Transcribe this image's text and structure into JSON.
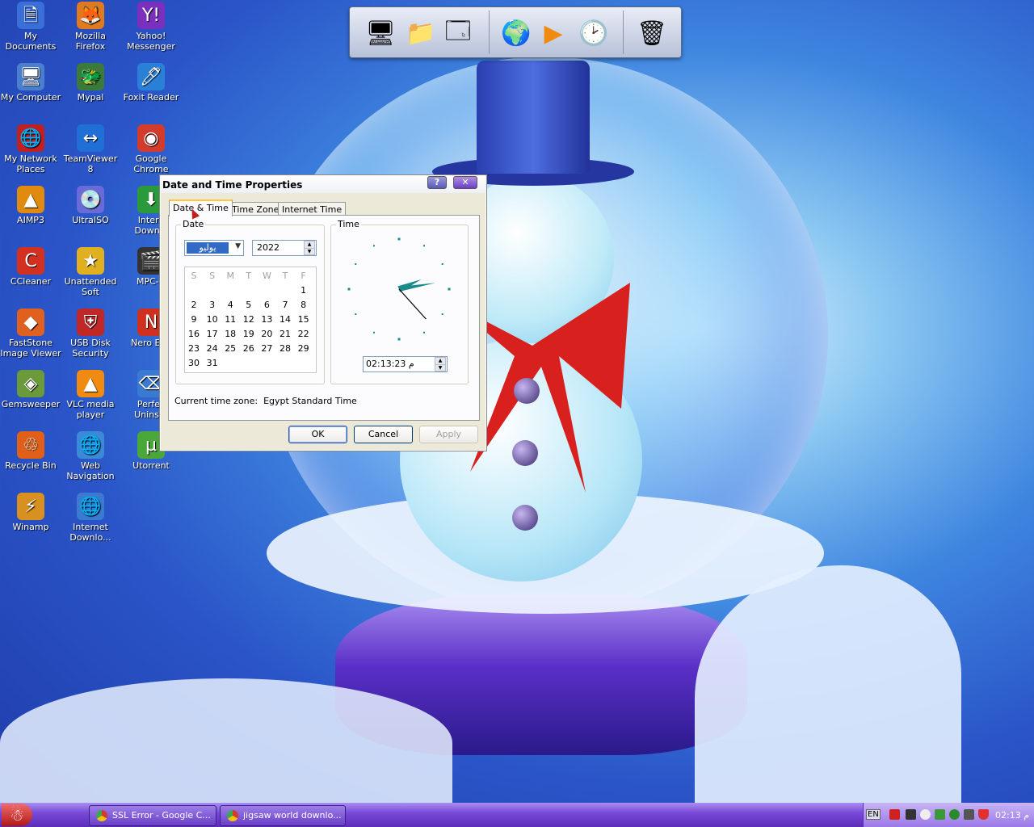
{
  "desktop": {
    "icons": [
      {
        "label": "My Documents",
        "glyph": "🗎",
        "color": "#3a6fd8"
      },
      {
        "label": "Mozilla Firefox",
        "glyph": "🦊",
        "color": "#e07a1f"
      },
      {
        "label": "Yahoo! Messenger",
        "glyph": "Y!",
        "color": "#7b2fbf"
      },
      {
        "label": "My Computer",
        "glyph": "🖥",
        "color": "#4a7fd0"
      },
      {
        "label": "Mypal",
        "glyph": "🐲",
        "color": "#3b7a3b"
      },
      {
        "label": "Foxit Reader",
        "glyph": "🖊",
        "color": "#2a7fd6"
      },
      {
        "label": "My Network Places",
        "glyph": "🌐",
        "color": "#c02020"
      },
      {
        "label": "TeamViewer 8",
        "glyph": "↔",
        "color": "#1f6fd6"
      },
      {
        "label": "Google Chrome",
        "glyph": "◉",
        "color": "#d33b2c"
      },
      {
        "label": "AIMP3",
        "glyph": "▲",
        "color": "#e08a10"
      },
      {
        "label": "UltraISO",
        "glyph": "💿",
        "color": "#6a6ad8"
      },
      {
        "label": "Intern Downlo",
        "glyph": "⬇",
        "color": "#2a9a3a"
      },
      {
        "label": "CCleaner",
        "glyph": "C",
        "color": "#d33020"
      },
      {
        "label": "Unattended Soft",
        "glyph": "★",
        "color": "#e0b020"
      },
      {
        "label": "MPC-H",
        "glyph": "🎬",
        "color": "#333333"
      },
      {
        "label": "FastStone Image Viewer",
        "glyph": "◆",
        "color": "#e06020"
      },
      {
        "label": "USB Disk Security",
        "glyph": "⛨",
        "color": "#c02828"
      },
      {
        "label": "Nero Exp",
        "glyph": "N",
        "color": "#d03020"
      },
      {
        "label": "Gemsweeper",
        "glyph": "◈",
        "color": "#6a9a3a"
      },
      {
        "label": "VLC media player",
        "glyph": "▲",
        "color": "#f08a10"
      },
      {
        "label": "Perfec Uninsta",
        "glyph": "⌫",
        "color": "#3a7ad0"
      },
      {
        "label": "Recycle Bin",
        "glyph": "♲",
        "color": "#e0601a"
      },
      {
        "label": "Web Navigation",
        "glyph": "🌐",
        "color": "#3a8ad8"
      },
      {
        "label": "Utorrent",
        "glyph": "µ",
        "color": "#4aa83a"
      },
      {
        "label": "Winamp",
        "glyph": "⚡",
        "color": "#d89020"
      },
      {
        "label": "Internet Downlo...",
        "glyph": "🌐",
        "color": "#3a7ad0"
      }
    ]
  },
  "dock": {
    "items": [
      {
        "name": "computer-icon",
        "glyph": "🖥"
      },
      {
        "name": "documents-icon",
        "glyph": "📁"
      },
      {
        "name": "control-panel-icon",
        "glyph": "🗔"
      },
      {
        "name": "globe-icon",
        "glyph": "🌍"
      },
      {
        "name": "media-player-icon",
        "glyph": "▶"
      },
      {
        "name": "clock-icon",
        "glyph": "🕑"
      },
      {
        "name": "trash-icon",
        "glyph": "🗑"
      }
    ]
  },
  "dialog": {
    "title": "Date and Time Properties",
    "help_label": "?",
    "close_label": "✕",
    "tabs": [
      "Date & Time",
      "Time Zone",
      "Internet Time"
    ],
    "date_group_label": "Date",
    "month_value": "يوليو",
    "year_value": "2022",
    "weekday_headers": [
      "S",
      "S",
      "M",
      "T",
      "W",
      "T",
      "F"
    ],
    "calendar_rows": [
      [
        "",
        "",
        "",
        "",
        "",
        "",
        "1"
      ],
      [
        "2",
        "3",
        "4",
        "5",
        "6",
        "7",
        "8"
      ],
      [
        "9",
        "10",
        "11",
        "12",
        "13",
        "14",
        "15"
      ],
      [
        "16",
        "17",
        "18",
        "19",
        "20",
        "21",
        "22"
      ],
      [
        "23",
        "24",
        "25",
        "26",
        "27",
        "28",
        "29"
      ],
      [
        "30",
        "31",
        "",
        "",
        "",
        "",
        ""
      ]
    ],
    "time_group_label": "Time",
    "time_value": "02:13:23 م",
    "timezone_text": "Current time zone:  Egypt Standard Time",
    "ok_label": "OK",
    "cancel_label": "Cancel",
    "apply_label": "Apply"
  },
  "taskbar": {
    "start_glyph": "☃",
    "tasks": [
      "SSL Error - Google C...",
      "jigsaw world downlo..."
    ],
    "language": "EN",
    "clock": "02:13 م"
  },
  "colors": {
    "taskbar": "#7a4bd8",
    "clock_hands": "#1a8a8a",
    "dialog_bg": "#ece9d8"
  }
}
